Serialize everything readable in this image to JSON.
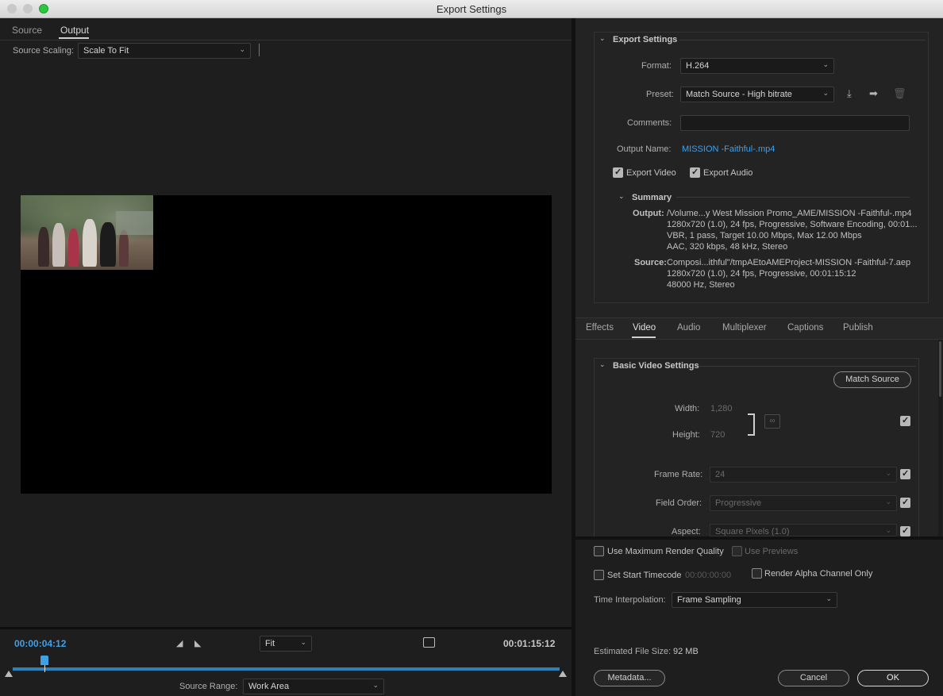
{
  "window": {
    "title": "Export Settings"
  },
  "left": {
    "tabs": [
      {
        "label": "Source",
        "active": false
      },
      {
        "label": "Output",
        "active": true
      }
    ],
    "source_scaling_label": "Source Scaling:",
    "source_scaling_value": "Scale To Fit",
    "current_timecode": "00:00:04:12",
    "duration_timecode": "00:01:15:12",
    "zoom_value": "Fit",
    "source_range_label": "Source Range:",
    "source_range_value": "Work Area",
    "timecode_color": "#3fa0e8",
    "playhead_fraction": 0.058
  },
  "export_settings": {
    "section_title": "Export Settings",
    "format_label": "Format:",
    "format_value": "H.264",
    "preset_label": "Preset:",
    "preset_value": "Match Source - High bitrate",
    "comments_label": "Comments:",
    "comments_value": "",
    "output_name_label": "Output Name:",
    "output_name_value": "MISSION -Faithful-.mp4",
    "export_video_label": "Export Video",
    "export_video_checked": true,
    "export_audio_label": "Export Audio",
    "export_audio_checked": true,
    "summary": {
      "title": "Summary",
      "output_label": "Output:",
      "output_lines": [
        "/Volume...y West Mission Promo_AME/MISSION -Faithful-.mp4",
        "1280x720 (1.0), 24 fps, Progressive, Software Encoding, 00:01...",
        "VBR, 1 pass, Target 10.00 Mbps, Max 12.00 Mbps",
        "AAC, 320 kbps, 48 kHz, Stereo"
      ],
      "source_label": "Source:",
      "source_lines": [
        "Composi...ithful\"/tmpAEtoAMEProject-MISSION -Faithful-7.aep",
        "1280x720 (1.0), 24 fps, Progressive, 00:01:15:12",
        "48000 Hz, Stereo"
      ]
    }
  },
  "settings_tabs": [
    {
      "label": "Effects",
      "active": false
    },
    {
      "label": "Video",
      "active": true
    },
    {
      "label": "Audio",
      "active": false
    },
    {
      "label": "Multiplexer",
      "active": false
    },
    {
      "label": "Captions",
      "active": false
    },
    {
      "label": "Publish",
      "active": false
    }
  ],
  "basic_video": {
    "section_title": "Basic Video Settings",
    "match_source_label": "Match Source",
    "width_label": "Width:",
    "width_value": "1,280",
    "height_label": "Height:",
    "height_value": "720",
    "frame_rate_label": "Frame Rate:",
    "frame_rate_value": "24",
    "field_order_label": "Field Order:",
    "field_order_value": "Progressive",
    "aspect_label": "Aspect:",
    "aspect_value": "Square Pixels (1.0)"
  },
  "options": {
    "max_render_quality_label": "Use Maximum Render Quality",
    "use_previews_label": "Use Previews",
    "set_start_timecode_label": "Set Start Timecode",
    "start_timecode_value": "00:00:00:00",
    "render_alpha_label": "Render Alpha Channel Only",
    "time_interpolation_label": "Time Interpolation:",
    "time_interpolation_value": "Frame Sampling",
    "estimated_size_label": "Estimated File Size:",
    "estimated_size_value": "92 MB"
  },
  "buttons": {
    "metadata": "Metadata...",
    "cancel": "Cancel",
    "ok": "OK"
  }
}
